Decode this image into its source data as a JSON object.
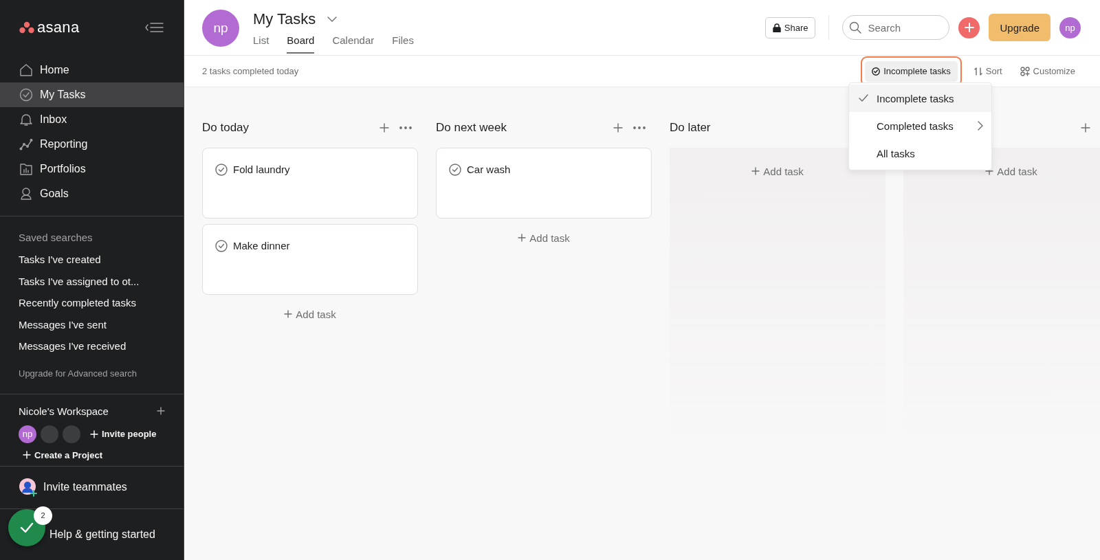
{
  "sidebar": {
    "logo": "asana",
    "nav": [
      {
        "label": "Home",
        "selected": false
      },
      {
        "label": "My Tasks",
        "selected": true
      },
      {
        "label": "Inbox",
        "selected": false
      },
      {
        "label": "Reporting",
        "selected": false
      },
      {
        "label": "Portfolios",
        "selected": false
      },
      {
        "label": "Goals",
        "selected": false
      }
    ],
    "saved_searches": {
      "heading": "Saved searches",
      "items": [
        "Tasks I've created",
        "Tasks I've assigned to ot...",
        "Recently completed tasks",
        "Messages I've sent",
        "Messages I've received"
      ],
      "upgrade_link": "Upgrade for Advanced search"
    },
    "workspace": {
      "name": "Nicole's Workspace",
      "members": [
        {
          "kind": "initials",
          "initials": "np"
        },
        {
          "kind": "blank"
        },
        {
          "kind": "blank"
        }
      ],
      "invite": "Invite people",
      "create_project": "Create a Project"
    },
    "invite_teammates": "Invite teammates",
    "help": {
      "label": "Help & getting started",
      "badge": "2"
    }
  },
  "header": {
    "avatar": "np",
    "title": "My Tasks",
    "tabs": [
      {
        "label": "List",
        "selected": false
      },
      {
        "label": "Board",
        "selected": true
      },
      {
        "label": "Calendar",
        "selected": false
      },
      {
        "label": "Files",
        "selected": false
      }
    ],
    "share": "Share",
    "search": {
      "placeholder": "Search"
    },
    "upgrade": "Upgrade",
    "user_avatar": "np"
  },
  "toolbar": {
    "status": "2 tasks completed today",
    "filter": "Incomplete tasks",
    "sort": "Sort",
    "customize": "Customize"
  },
  "filter_menu": [
    {
      "label": "Incomplete tasks",
      "selected": true,
      "kind": "option"
    },
    {
      "label": "Completed tasks",
      "selected": false,
      "kind": "submenu"
    },
    {
      "label": "All tasks",
      "selected": false,
      "kind": "option"
    }
  ],
  "columns": [
    {
      "title": "Do today",
      "tasks": [
        "Fold laundry",
        "Make dinner"
      ],
      "add_task": "Add task"
    },
    {
      "title": "Do next week",
      "tasks": [
        "Car wash"
      ],
      "add_task": "Add task"
    },
    {
      "title": "Do later",
      "kind": "covered",
      "add_task": "Add task"
    },
    {
      "add_task": "Add task"
    }
  ]
}
